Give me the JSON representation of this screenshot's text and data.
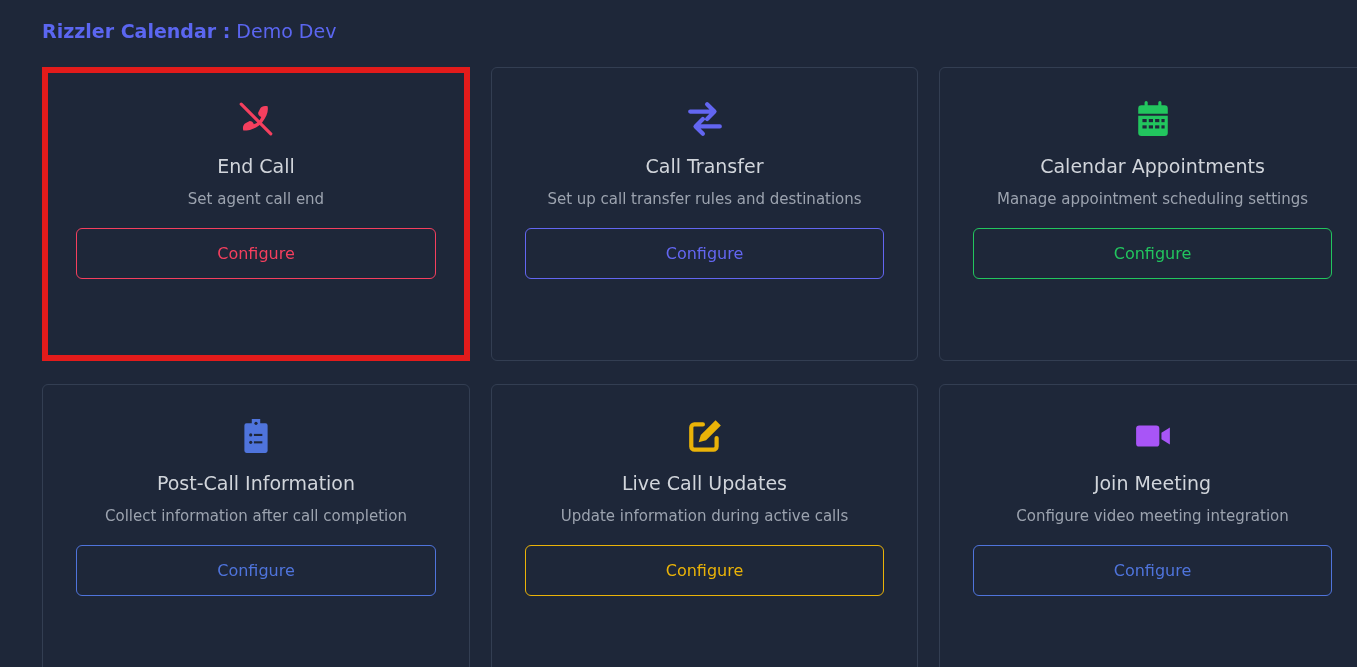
{
  "header": {
    "app": "Rizzler Calendar :",
    "workspace": "Demo Dev"
  },
  "cards": [
    {
      "kind": "phone-slash",
      "color": "#f43f5e",
      "title": "End Call",
      "description": "Set agent call end",
      "button": {
        "label": "Configure",
        "color": "#f43f5e"
      },
      "highlighted": true
    },
    {
      "kind": "arrows",
      "color": "#6366f1",
      "title": "Call Transfer",
      "description": "Set up call transfer rules and destinations",
      "button": {
        "label": "Configure",
        "color": "#6366f1"
      },
      "highlighted": false
    },
    {
      "kind": "calendar",
      "color": "#22c55e",
      "title": "Calendar Appointments",
      "description": "Manage appointment scheduling settings",
      "button": {
        "label": "Configure",
        "color": "#22c55e"
      },
      "highlighted": false
    },
    {
      "kind": "clipboard",
      "color": "#4f74dc",
      "title": "Post-Call Information",
      "description": "Collect information after call completion",
      "button": {
        "label": "Configure",
        "color": "#4f74dc"
      },
      "highlighted": false
    },
    {
      "kind": "edit",
      "color": "#eab308",
      "title": "Live Call Updates",
      "description": "Update information during active calls",
      "button": {
        "label": "Configure",
        "color": "#eab308"
      },
      "highlighted": false
    },
    {
      "kind": "video",
      "color": "#a855f7",
      "title": "Join Meeting",
      "description": "Configure video meeting integration",
      "button": {
        "label": "Configure",
        "color": "#4f74dc"
      },
      "highlighted": false
    }
  ]
}
